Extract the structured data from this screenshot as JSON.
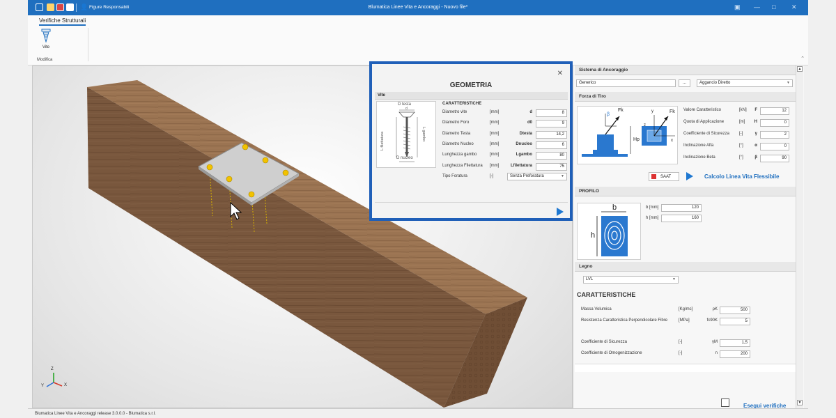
{
  "window": {
    "title": "Blumatica Linee Vita e Ancoraggi - Nuovo file*",
    "quick_access_label": "Figure Responsabili"
  },
  "ribbon": {
    "tab": "Verifiche Strutturali",
    "vite_button": "Vite",
    "group": "Modifica"
  },
  "viewport": {
    "axis_x": "X",
    "axis_y": "Y",
    "axis_z": "Z"
  },
  "dialog": {
    "title": "GEOMETRIA",
    "section": "Vite",
    "subsection": "CARATTERISTICHE",
    "diagram": {
      "d_testa": "D testa",
      "d": "d",
      "l_filettatura": "L filettatura",
      "l_gambo": "L gambo",
      "d_nucleo": "D nucleo"
    },
    "rows": [
      {
        "label": "Diametro vite",
        "unit": "[mm]",
        "symbol": "d",
        "value": "8"
      },
      {
        "label": "Diametro Foro",
        "unit": "[mm]",
        "symbol": "d0",
        "value": "9"
      },
      {
        "label": "Diametro Testa",
        "unit": "[mm]",
        "symbol": "Dtesta",
        "value": "14,2"
      },
      {
        "label": "Diametro Nucleo",
        "unit": "[mm]",
        "symbol": "Dnucleo",
        "value": "6"
      },
      {
        "label": "Lunghezza gambo",
        "unit": "[mm]",
        "symbol": "Lgambo",
        "value": "80"
      },
      {
        "label": "Lunghezza Filettatura",
        "unit": "[mm]",
        "symbol": "Lfilettatura",
        "value": "75"
      }
    ],
    "foratura": {
      "label": "Tipo Foratura",
      "unit": "[-]",
      "value": "Senza Preforatura"
    }
  },
  "right_panel": {
    "sistema": {
      "header": "Sistema di Ancoraggio",
      "field_value": "Generico",
      "browse_label": "...",
      "type_value": "Aggancio Diretto"
    },
    "forza": {
      "header": "Forza di Tiro",
      "diagram": {
        "fk": "Fk",
        "beta": "β",
        "alpha": "α",
        "hp": "Hp",
        "x": "x",
        "z": "z",
        "y": "y"
      },
      "rows": [
        {
          "label": "Valore Caratteristico",
          "unit": "[kN]",
          "symbol": "F",
          "value": "12"
        },
        {
          "label": "Quota di Applicazione",
          "unit": "[m]",
          "symbol": "H",
          "value": "0"
        },
        {
          "label": "Coefficiente di Sicurezza",
          "unit": "[-]",
          "symbol": "γ",
          "value": "2"
        },
        {
          "label": "Inclinazione Alfa",
          "unit": "[°]",
          "symbol": "α",
          "value": "0"
        },
        {
          "label": "Inclinazione Beta",
          "unit": "[°]",
          "symbol": "β",
          "value": "90"
        }
      ],
      "saat_label": "SAAT",
      "calcolo_label": "Calcolo Linea Vita Flessibile"
    },
    "profilo": {
      "header": "PROFILO",
      "diagram_b": "b",
      "diagram_h": "h",
      "b_label": "b [mm]",
      "b_value": "120",
      "h_label": "h [mm]",
      "h_value": "160"
    },
    "legno": {
      "header": "Legno",
      "material": "LVL",
      "car_title": "CARATTERISTICHE",
      "rows": [
        {
          "label": "Massa Volumica",
          "unit": "[Kg/mc]",
          "symbol": "ρK",
          "value": "500"
        },
        {
          "label": "Resistenza Caratteristica Perpendicolare Fibre",
          "unit": "[MPa]",
          "symbol": "fc90K",
          "value": "5"
        }
      ],
      "rows2": [
        {
          "label": "Coefficiente di Sicurezza",
          "unit": "[-]",
          "symbol": "γM",
          "value": "1,5"
        },
        {
          "label": "Coefficiente di Omogenizzazione",
          "unit": "[-]",
          "symbol": "n",
          "value": "200"
        }
      ],
      "esegui_label": "Esegui verifiche"
    }
  },
  "status": {
    "text": "Blumatica Linee Vita e Ancoraggi release 3.0.0.0 - Blumatica s.r.l."
  },
  "colors": {
    "accent": "#1f6fbf",
    "dialog_border": "#1f5fb8",
    "wood": "#8a6446",
    "plate": "#c9c9c9",
    "screw": "#f2c200"
  }
}
